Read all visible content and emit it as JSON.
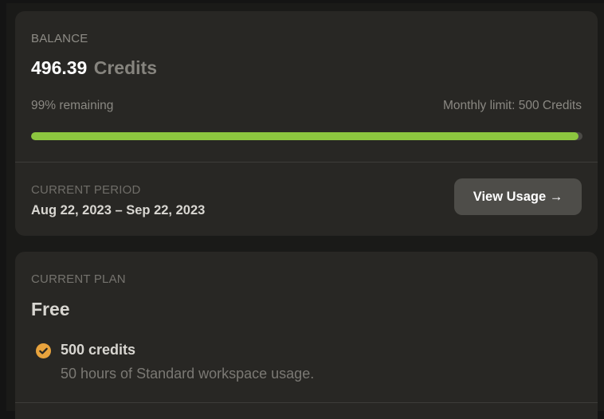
{
  "balance": {
    "label": "BALANCE",
    "amount": "496.39",
    "unit": "Credits",
    "remaining_text": "99% remaining",
    "limit_text": "Monthly limit: 500 Credits",
    "progress_fraction": 0.9928,
    "progress_color": "#8cc63f"
  },
  "period": {
    "label": "CURRENT PERIOD",
    "value": "Aug 22, 2023 – Sep 22, 2023",
    "button_label": "View Usage →"
  },
  "plan": {
    "label": "CURRENT PLAN",
    "name": "Free",
    "feature": {
      "icon": "check-circle-icon",
      "icon_color": "#e8a33d",
      "title": "500 credits",
      "description": "50 hours of Standard workspace usage."
    }
  }
}
